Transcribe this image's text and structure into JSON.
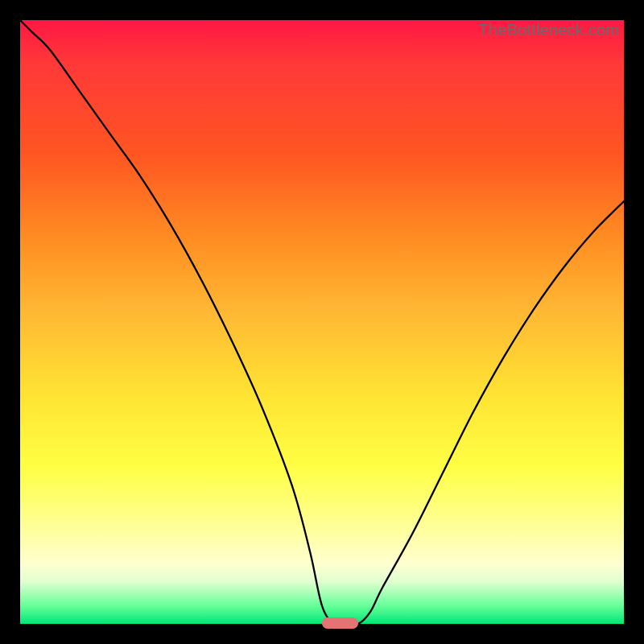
{
  "watermark": "TheBottleneck.com",
  "colors": {
    "page_bg": "#000000",
    "curve": "#000000",
    "marker": "#e57373"
  },
  "chart_data": {
    "type": "line",
    "title": "",
    "xlabel": "",
    "ylabel": "",
    "xlim": [
      0,
      100
    ],
    "ylim": [
      0,
      100
    ],
    "grid": false,
    "legend": false,
    "x": [
      0,
      2,
      5,
      10,
      15,
      20,
      25,
      30,
      35,
      40,
      45,
      48,
      50,
      52,
      54,
      56,
      58,
      60,
      65,
      70,
      75,
      80,
      85,
      90,
      95,
      100
    ],
    "values": [
      100,
      98,
      95,
      88,
      81,
      74,
      66,
      57,
      47,
      36,
      23,
      12,
      3,
      0,
      0,
      0,
      2,
      6,
      15,
      25,
      35,
      44,
      52,
      59,
      65,
      70
    ],
    "marker": {
      "x_center": 53,
      "y": 0,
      "width_pct": 6
    },
    "annotations": [
      "TheBottleneck.com"
    ]
  }
}
